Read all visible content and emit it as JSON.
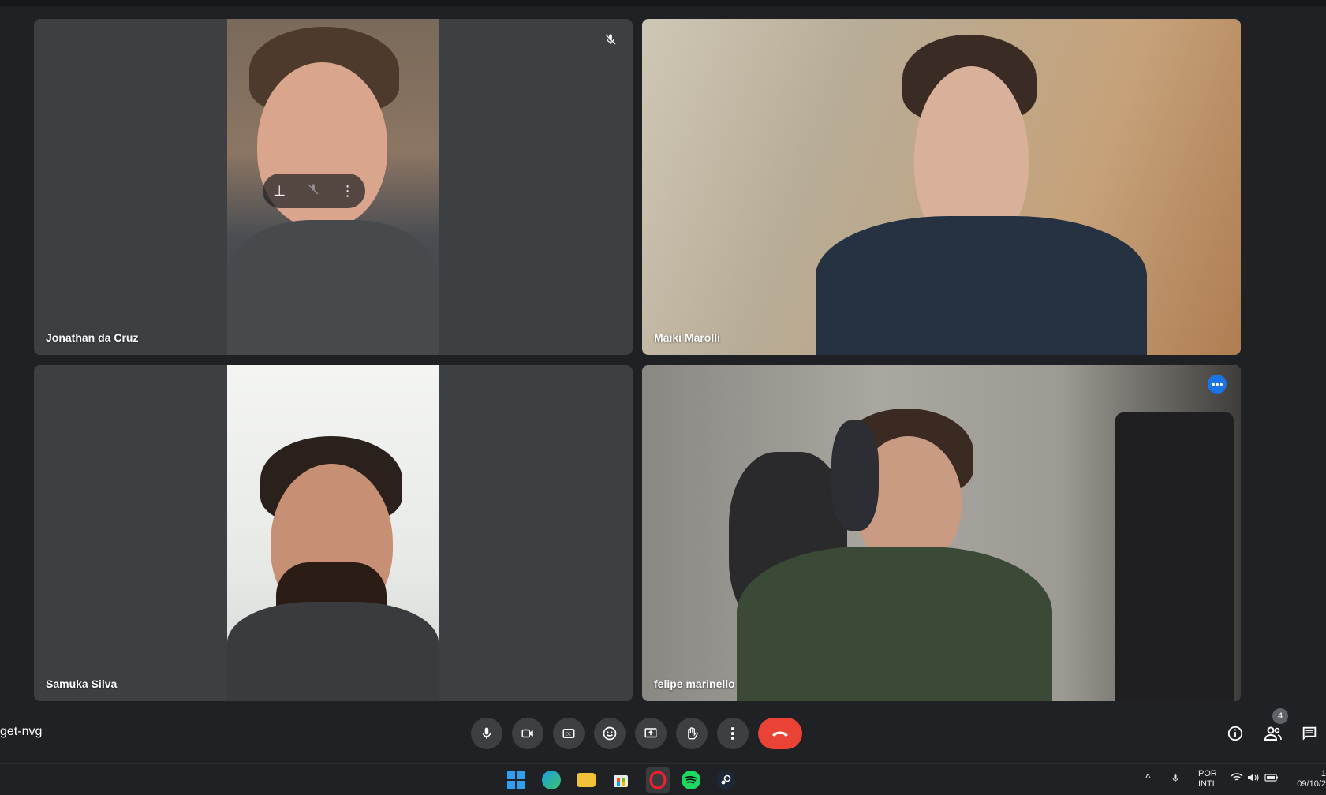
{
  "participants": [
    {
      "name": "Jonathan da Cruz"
    },
    {
      "name": "Maiki Marolli"
    },
    {
      "name": "Samuka Silva"
    },
    {
      "name": "felipe marinello"
    }
  ],
  "meeting_code": "get-nvg",
  "people_count": "4",
  "system_tray": {
    "lang_line1": "POR",
    "lang_line2": "INTL",
    "time": "1",
    "date": "09/10/2"
  },
  "colors": {
    "background": "#202124",
    "tile": "#3c4043",
    "hangup": "#ea4335",
    "active_outline": "#8ab4f8",
    "more_button": "#1a73e8"
  },
  "icons": {
    "microphone": "mic-icon",
    "camera": "camera-icon",
    "captions": "captions-icon",
    "emoji": "emoji-icon",
    "present": "present-screen-icon",
    "raise_hand": "raise-hand-icon",
    "more": "more-options-icon",
    "hangup": "end-call-icon",
    "info": "info-icon",
    "people": "people-icon",
    "chat": "chat-icon"
  }
}
